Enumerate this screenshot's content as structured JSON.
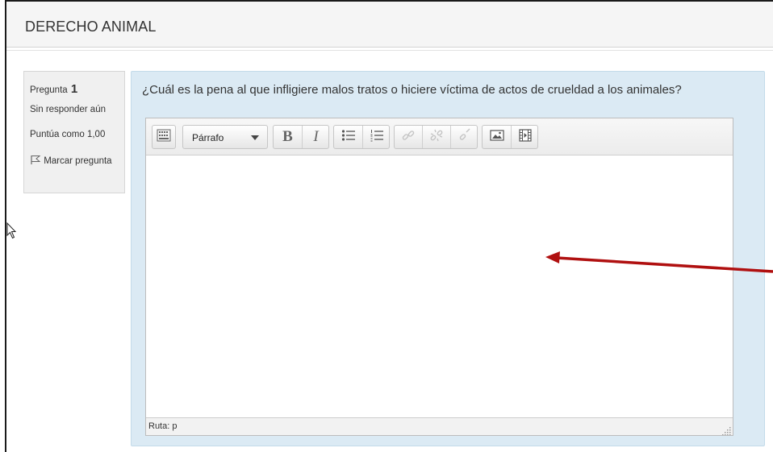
{
  "course": {
    "title": "DERECHO ANIMAL"
  },
  "question_info": {
    "number_label": "Pregunta",
    "number": "1",
    "state": "Sin responder aún",
    "grade": "Puntúa como 1,00",
    "flag_label": "Marcar pregunta"
  },
  "question": {
    "text": "¿Cuál es la pena al que infligiere malos tratos o hiciere víctima de actos de crueldad a los animales?"
  },
  "editor": {
    "toolbar": {
      "toggle_icon": "keyboard-toggle-icon",
      "format_value": "Párrafo",
      "bold_label": "B",
      "italic_label": "I",
      "icons": [
        "bullet-list-icon",
        "numbered-list-icon",
        "link-icon",
        "unlink-icon",
        "anchor-icon",
        "image-icon",
        "media-icon"
      ]
    },
    "content": "",
    "path_label": "Ruta: p"
  },
  "colors": {
    "question_bg": "#dbeaf4",
    "annotation_arrow": "#b01010"
  }
}
